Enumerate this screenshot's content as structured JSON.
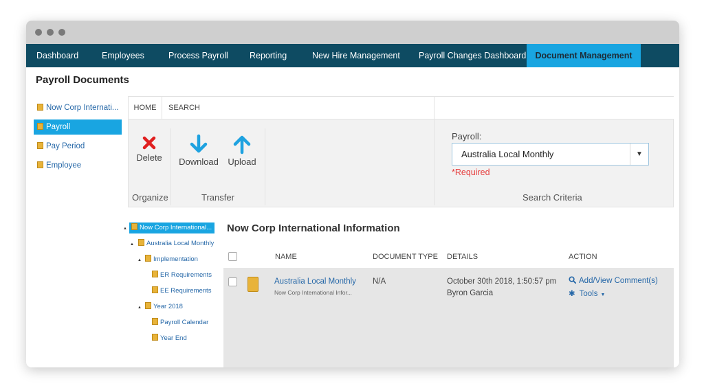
{
  "nav": {
    "items": [
      {
        "label": "Dashboard"
      },
      {
        "label": "Employees"
      },
      {
        "label": "Process Payroll"
      },
      {
        "label": "Reporting"
      },
      {
        "label": "New Hire Management"
      },
      {
        "label": "Payroll Changes Dashboard"
      },
      {
        "label": "Document Management",
        "active": true
      }
    ]
  },
  "page": {
    "title": "Payroll Documents"
  },
  "sidebar": {
    "items": [
      {
        "label": "Now Corp Internati...",
        "icon": "folder-icon"
      },
      {
        "label": "Payroll",
        "icon": "folder-icon",
        "active": true
      },
      {
        "label": "Pay Period",
        "icon": "folder-icon"
      },
      {
        "label": "Employee",
        "icon": "folder-icon"
      }
    ]
  },
  "ribbon": {
    "tabs": [
      {
        "label": "HOME"
      },
      {
        "label": "SEARCH"
      }
    ],
    "delete_label": "Delete",
    "download_label": "Download",
    "upload_label": "Upload",
    "groups": {
      "organize": "Organize",
      "transfer": "Transfer",
      "search_criteria": "Search Criteria"
    },
    "payroll_label": "Payroll:",
    "payroll_value": "Australia Local Monthly",
    "required_text": "*Required"
  },
  "tree": {
    "items": [
      {
        "label": "Now Corp International..."
      },
      {
        "label": "Australia Local Monthly"
      },
      {
        "label": "Implementation"
      },
      {
        "label": "ER Requirements"
      },
      {
        "label": "EE Requirements"
      },
      {
        "label": "Year 2018"
      },
      {
        "label": "Payroll Calendar"
      },
      {
        "label": "Year End"
      }
    ]
  },
  "content": {
    "title": "Now Corp International Information",
    "columns": {
      "name": "NAME",
      "document_type": "DOCUMENT TYPE",
      "details": "DETAILS",
      "action": "ACTION"
    },
    "rows": [
      {
        "name": "Australia Local Monthly",
        "subtitle": "Now Corp International Infor...",
        "document_type": "N/A",
        "details_date": "October 30th 2018, 1:50:57 pm",
        "details_user": "Byron Garcia",
        "action_comment": "Add/View Comment(s)",
        "action_tools": "Tools"
      }
    ]
  },
  "colors": {
    "nav_bg": "#0e4b62",
    "accent": "#19a5e1",
    "link": "#2668a8",
    "required": "#e63c3c",
    "delete": "#e02020"
  }
}
